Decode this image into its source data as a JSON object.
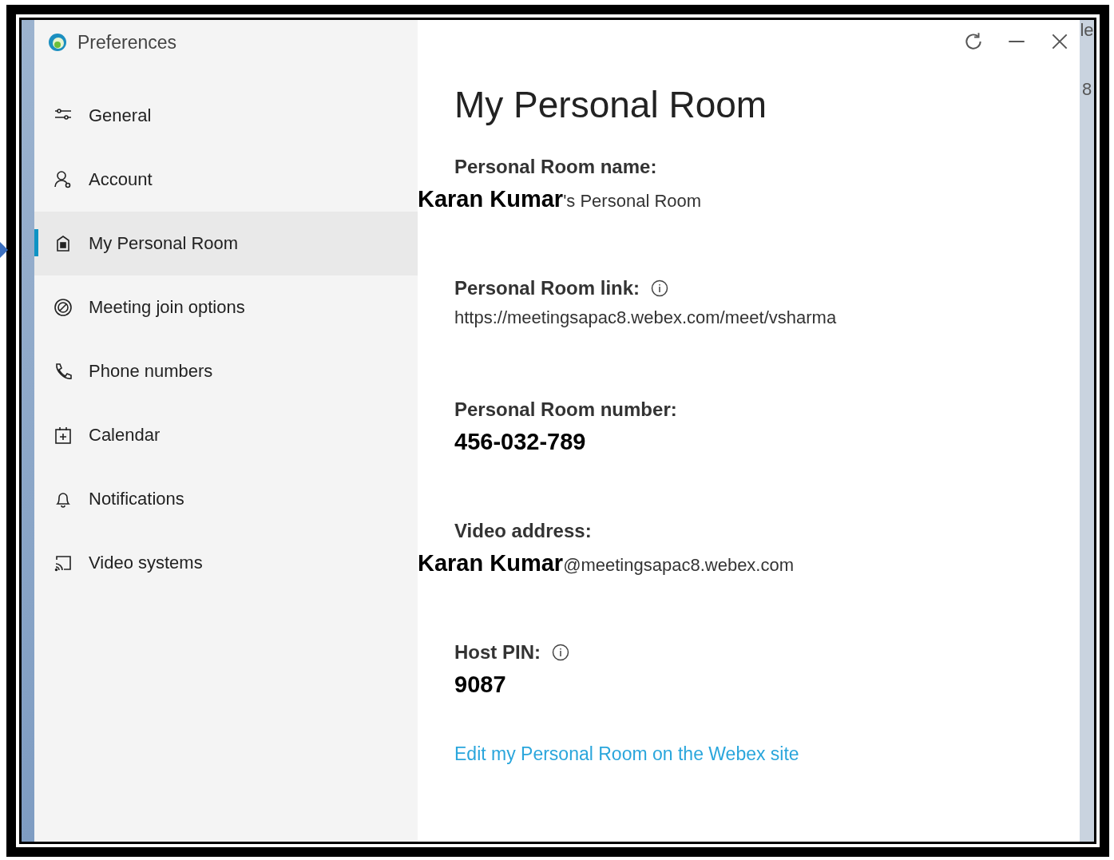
{
  "window": {
    "title": "Preferences",
    "controls": [
      {
        "kind": "refresh"
      },
      {
        "kind": "minimize"
      },
      {
        "kind": "close"
      }
    ]
  },
  "background_window": {
    "texts": [
      "le",
      "8"
    ]
  },
  "sidebar": {
    "items": [
      {
        "label": "General",
        "selected": false
      },
      {
        "label": "Account",
        "selected": false
      },
      {
        "label": "My Personal Room",
        "selected": true
      },
      {
        "label": "Meeting join options",
        "selected": false
      },
      {
        "label": "Phone numbers",
        "selected": false
      },
      {
        "label": "Calendar",
        "selected": false
      },
      {
        "label": "Notifications",
        "selected": false
      },
      {
        "label": "Video systems",
        "selected": false
      }
    ]
  },
  "content": {
    "heading": "My Personal Room",
    "fields": [
      {
        "label": "Personal Room name:",
        "info": false,
        "overlay": "Karan Kumar",
        "value": "'s Personal Room"
      },
      {
        "label": "Personal Room link:",
        "info": true,
        "value": "https://meetingsapac8.webex.com/meet/vsharma"
      },
      {
        "label": "Personal Room number:",
        "info": false,
        "overlay": "456-032-789"
      },
      {
        "label": "Video address:",
        "info": false,
        "overlay": "Karan Kumar",
        "value": "@meetingsapac8.webex.com"
      },
      {
        "label": "Host PIN:",
        "info": true,
        "overlay": "9087"
      }
    ],
    "link": "Edit my Personal Room on the Webex site"
  }
}
